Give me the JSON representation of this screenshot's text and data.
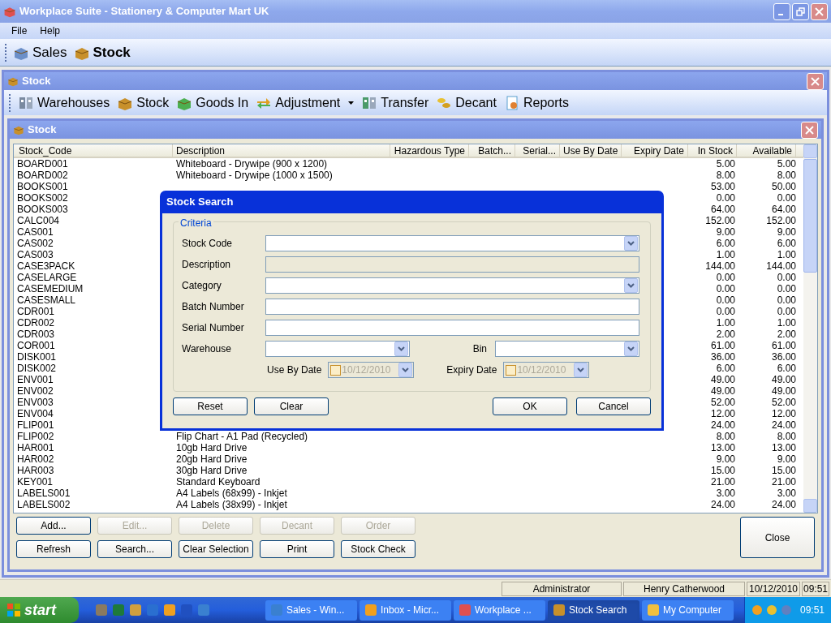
{
  "window": {
    "title": "Workplace Suite - Stationery & Computer Mart UK"
  },
  "menu": [
    "File",
    "Help"
  ],
  "main_toolbar": [
    {
      "label": "Sales",
      "selected": false
    },
    {
      "label": "Stock",
      "selected": true
    }
  ],
  "stock_window": {
    "title": "Stock",
    "toolbar": [
      {
        "label": "Warehouses",
        "dropdown": false
      },
      {
        "label": "Stock",
        "dropdown": false
      },
      {
        "label": "Goods In",
        "dropdown": false
      },
      {
        "label": "Adjustment",
        "dropdown": true
      },
      {
        "label": "Transfer",
        "dropdown": false
      },
      {
        "label": "Decant",
        "dropdown": false
      },
      {
        "label": "Reports",
        "dropdown": false
      }
    ]
  },
  "stock_list": {
    "title": "Stock",
    "columns": [
      "Stock_Code",
      "Description",
      "Hazardous Type",
      "Batch...",
      "Serial...",
      "Use By Date",
      "Expiry Date",
      "In Stock",
      "Available"
    ],
    "rows": [
      {
        "stock_code": "BOARD001",
        "description": "Whiteboard - Drywipe (900 x 1200)",
        "in_stock": "5.00",
        "available": "5.00"
      },
      {
        "stock_code": "BOARD002",
        "description": "Whiteboard - Drywipe (1000 x 1500)",
        "in_stock": "8.00",
        "available": "8.00"
      },
      {
        "stock_code": "BOOKS001",
        "in_stock": "53.00",
        "available": "50.00"
      },
      {
        "stock_code": "BOOKS002",
        "in_stock": "0.00",
        "available": "0.00"
      },
      {
        "stock_code": "BOOKS003",
        "in_stock": "64.00",
        "available": "64.00"
      },
      {
        "stock_code": "CALC004",
        "in_stock": "152.00",
        "available": "152.00"
      },
      {
        "stock_code": "CAS001",
        "in_stock": "9.00",
        "available": "9.00"
      },
      {
        "stock_code": "CAS002",
        "in_stock": "6.00",
        "available": "6.00"
      },
      {
        "stock_code": "CAS003",
        "in_stock": "1.00",
        "available": "1.00"
      },
      {
        "stock_code": "CASE3PACK",
        "in_stock": "144.00",
        "available": "144.00"
      },
      {
        "stock_code": "CASELARGE",
        "in_stock": "0.00",
        "available": "0.00"
      },
      {
        "stock_code": "CASEMEDIUM",
        "in_stock": "0.00",
        "available": "0.00"
      },
      {
        "stock_code": "CASESMALL",
        "in_stock": "0.00",
        "available": "0.00"
      },
      {
        "stock_code": "CDR001",
        "in_stock": "0.00",
        "available": "0.00"
      },
      {
        "stock_code": "CDR002",
        "in_stock": "1.00",
        "available": "1.00"
      },
      {
        "stock_code": "CDR003",
        "in_stock": "2.00",
        "available": "2.00"
      },
      {
        "stock_code": "COR001",
        "in_stock": "61.00",
        "available": "61.00"
      },
      {
        "stock_code": "DISK001",
        "in_stock": "36.00",
        "available": "36.00"
      },
      {
        "stock_code": "DISK002",
        "in_stock": "6.00",
        "available": "6.00"
      },
      {
        "stock_code": "ENV001",
        "in_stock": "49.00",
        "available": "49.00"
      },
      {
        "stock_code": "ENV002",
        "in_stock": "49.00",
        "available": "49.00"
      },
      {
        "stock_code": "ENV003",
        "in_stock": "52.00",
        "available": "52.00"
      },
      {
        "stock_code": "ENV004",
        "in_stock": "12.00",
        "available": "12.00"
      },
      {
        "stock_code": "FLIP001",
        "in_stock": "24.00",
        "available": "24.00"
      },
      {
        "stock_code": "FLIP002",
        "description": "Flip Chart - A1 Pad (Recycled)",
        "in_stock": "8.00",
        "available": "8.00"
      },
      {
        "stock_code": "HAR001",
        "description": "10gb Hard Drive",
        "in_stock": "13.00",
        "available": "13.00"
      },
      {
        "stock_code": "HAR002",
        "description": "20gb Hard Drive",
        "in_stock": "9.00",
        "available": "9.00"
      },
      {
        "stock_code": "HAR003",
        "description": "30gb Hard Drive",
        "in_stock": "15.00",
        "available": "15.00"
      },
      {
        "stock_code": "KEY001",
        "description": "Standard Keyboard",
        "in_stock": "21.00",
        "available": "21.00"
      },
      {
        "stock_code": "LABELS001",
        "description": "A4 Labels (68x99) - Inkjet",
        "in_stock": "3.00",
        "available": "3.00"
      },
      {
        "stock_code": "LABELS002",
        "description": "A4 Labels (38x99) - Inkjet",
        "in_stock": "24.00",
        "available": "24.00"
      }
    ],
    "buttons_top": [
      {
        "label": "Add...",
        "disabled": false
      },
      {
        "label": "Edit...",
        "disabled": true
      },
      {
        "label": "Delete",
        "disabled": true
      },
      {
        "label": "Decant",
        "disabled": true
      },
      {
        "label": "Order",
        "disabled": true
      }
    ],
    "buttons_bottom": [
      {
        "label": "Refresh",
        "disabled": false
      },
      {
        "label": "Search...",
        "disabled": false
      },
      {
        "label": "Clear Selection",
        "disabled": false
      },
      {
        "label": "Print",
        "disabled": false
      },
      {
        "label": "Stock Check",
        "disabled": false
      }
    ],
    "close_button": "Close"
  },
  "dialog": {
    "title": "Stock Search",
    "group": "Criteria",
    "fields": [
      {
        "label": "Stock Code",
        "kind": "combo",
        "disabled": false
      },
      {
        "label": "Description",
        "kind": "text",
        "disabled": true
      },
      {
        "label": "Category",
        "kind": "combo",
        "disabled": false
      },
      {
        "label": "Batch Number",
        "kind": "text",
        "disabled": false
      },
      {
        "label": "Serial Number",
        "kind": "text",
        "disabled": false
      }
    ],
    "warehouse": {
      "label": "Warehouse"
    },
    "bin": {
      "label": "Bin"
    },
    "dates": [
      {
        "label": "Use By Date",
        "value": "10/12/2010",
        "checked": false
      },
      {
        "label": "Expiry Date",
        "value": "10/12/2010",
        "checked": false
      }
    ],
    "buttons_left": [
      "Reset",
      "Clear"
    ],
    "buttons_right": [
      "OK",
      "Cancel"
    ]
  },
  "status_bar": [
    "Administrator",
    "Henry Catherwood",
    "10/12/2010",
    "09:51"
  ],
  "taskbar": {
    "start": "start",
    "tasks": [
      {
        "label": "Sales - Win...",
        "selected": false
      },
      {
        "label": "Inbox - Micr...",
        "selected": false
      },
      {
        "label": "Workplace ...",
        "selected": false
      },
      {
        "label": "Stock Search",
        "selected": true
      },
      {
        "label": "My Computer",
        "selected": false
      }
    ],
    "clock": "09:51"
  }
}
